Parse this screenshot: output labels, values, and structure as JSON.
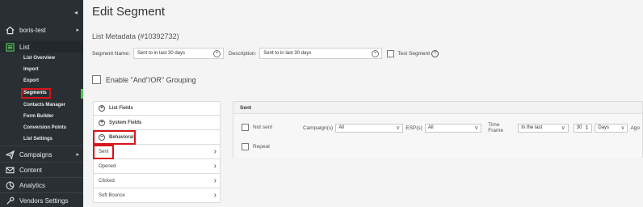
{
  "sidebar": {
    "collapse_glyph": "◂",
    "account": {
      "label": "boris-test",
      "icon": "home-icon",
      "arrow": "▸"
    },
    "list": {
      "label": "List",
      "icon": "list-icon"
    },
    "sub_items": [
      {
        "label": "List Overview"
      },
      {
        "label": "Import"
      },
      {
        "label": "Export"
      },
      {
        "label": "Segments"
      },
      {
        "label": "Contacts Manager"
      },
      {
        "label": "Form Builder"
      },
      {
        "label": "Conversion Points"
      },
      {
        "label": "List Settings"
      }
    ],
    "nav": [
      {
        "label": "Campaigns",
        "icon": "send-icon",
        "arrow": "▸"
      },
      {
        "label": "Content",
        "icon": "mail-icon"
      },
      {
        "label": "Analytics",
        "icon": "analytics-icon"
      },
      {
        "label": "Vendors Settings",
        "icon": "wrench-icon"
      }
    ],
    "accent_color": "#58c35c"
  },
  "page": {
    "title": "Edit Segment",
    "metadata_title": "List Metadata (#10392732)"
  },
  "form": {
    "segment_name_label": "Segment Name:",
    "segment_name_value": "Sent to in last 30 days",
    "description_label": "Description:",
    "description_value": "Sent to in last 30 days",
    "test_segment_label": "Test Segment",
    "help_glyph": "?",
    "clear_glyph": "×",
    "andor_label": "Enable \"And\"/OR\" Grouping"
  },
  "criteria": {
    "list_fields": "List Fields",
    "system_fields": "System Fields",
    "behavioral": "Behavioral",
    "items": [
      "Sent",
      "Opened",
      "Clicked",
      "Soft Bounce"
    ],
    "plus_glyph": "+",
    "minus_glyph": "−",
    "chevron_glyph": "›"
  },
  "sent_panel": {
    "header": "Sent",
    "not_sent_label": "Not sent",
    "campaigns_label": "Campaign(s)",
    "campaigns_value": "All",
    "esp_label": "ESP(s)",
    "esp_value": "All",
    "time_frame_label": "Time Frame",
    "time_frame_value": "In the last",
    "number_value": "30",
    "unit_value": "Days",
    "ago_label": "Ago",
    "repeat_label": "Repeat",
    "dropdown_glyph": "∨",
    "spinner_glyph": "⇕"
  },
  "colors": {
    "highlight": "#d9141b",
    "sidebar_bg": "#2a2f33"
  }
}
